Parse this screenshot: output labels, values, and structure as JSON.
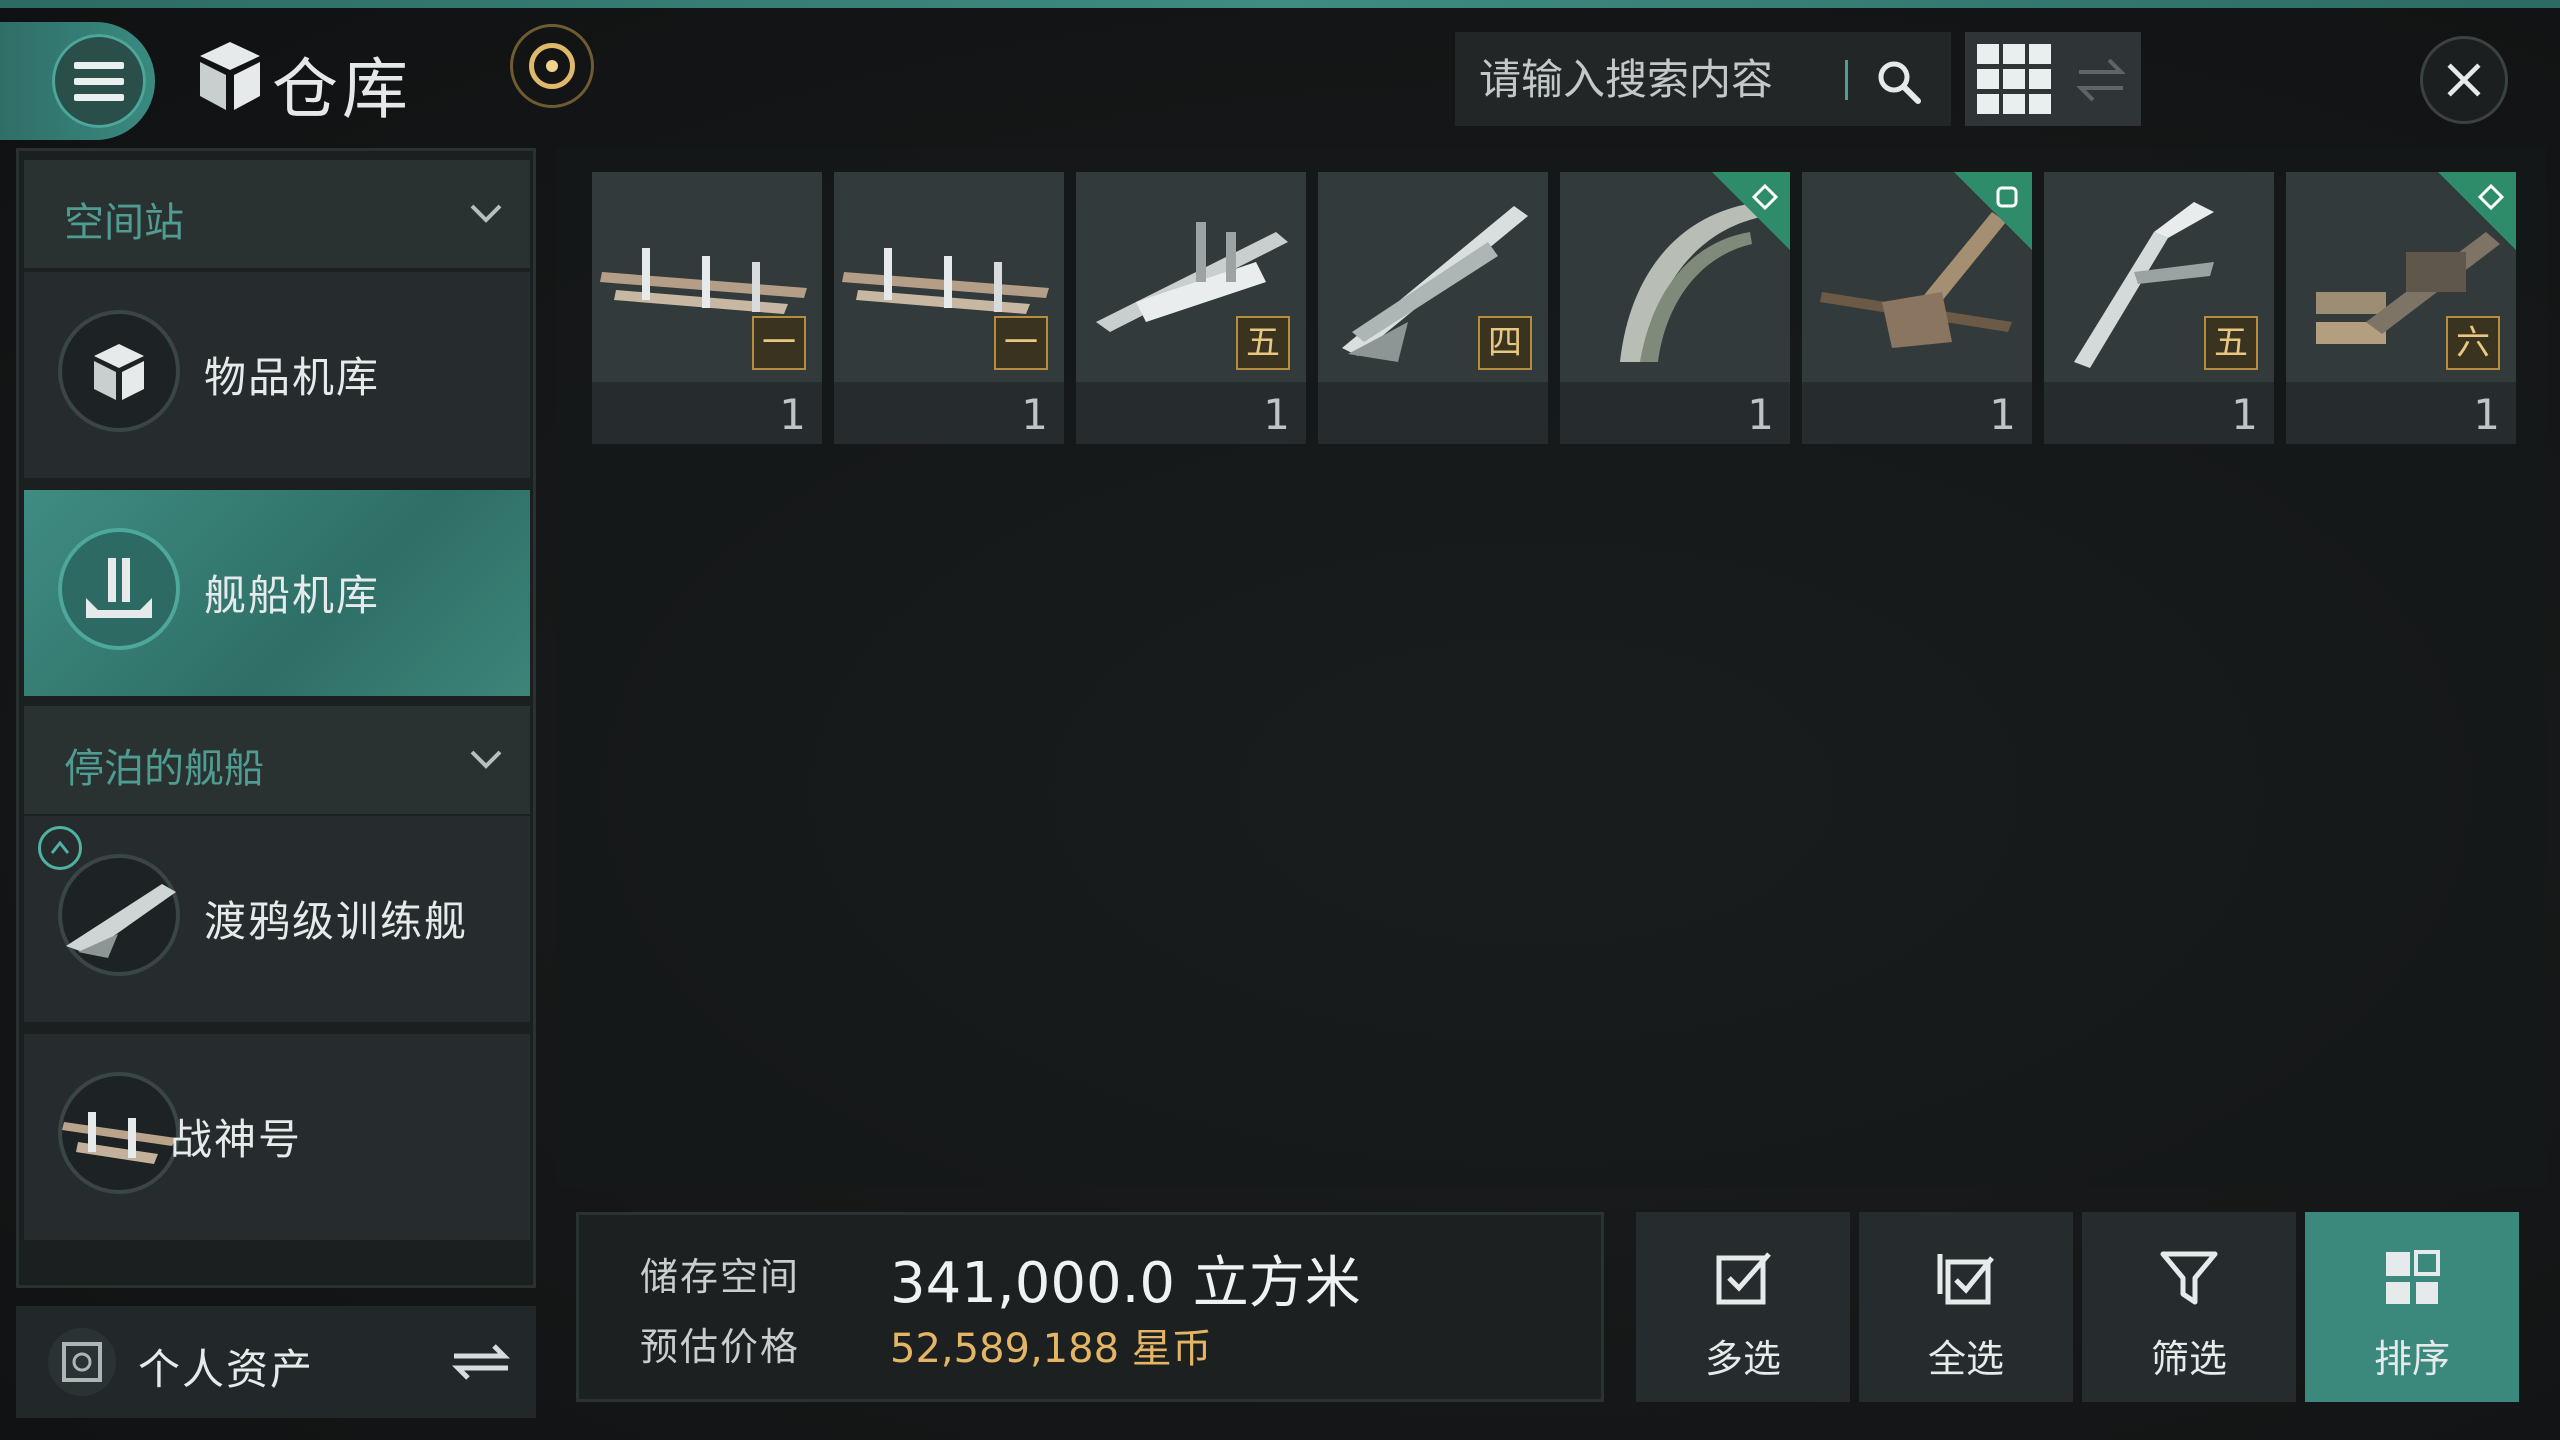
{
  "header": {
    "title": "仓库",
    "search_placeholder": "请输入搜索内容",
    "icons": [
      "menu-icon",
      "box-icon",
      "sun-icon",
      "search-icon",
      "grid-view-icon",
      "swap-icon",
      "close-icon"
    ]
  },
  "sidebar": {
    "station_label": "空间站",
    "items": [
      {
        "label": "物品机库",
        "icon": "box-icon",
        "active": false
      },
      {
        "label": "舰船机库",
        "icon": "ship-hangar-icon",
        "active": true
      }
    ],
    "docked_label": "停泊的舰船",
    "ships": [
      {
        "label": "渡鸦级训练舰",
        "icon": "ship-icon",
        "badge": "active-ship-badge"
      },
      {
        "label": "战神号",
        "icon": "ship-icon"
      }
    ],
    "assets_label": "个人资产"
  },
  "grid": {
    "items": [
      {
        "tier": "一",
        "qty": "1",
        "flag": ""
      },
      {
        "tier": "一",
        "qty": "1",
        "flag": ""
      },
      {
        "tier": "五",
        "qty": "1",
        "flag": ""
      },
      {
        "tier": "四",
        "qty": "",
        "flag": ""
      },
      {
        "tier": "",
        "qty": "1",
        "flag": "diamond"
      },
      {
        "tier": "",
        "qty": "1",
        "flag": "square"
      },
      {
        "tier": "五",
        "qty": "1",
        "flag": ""
      },
      {
        "tier": "六",
        "qty": "1",
        "flag": "diamond"
      }
    ]
  },
  "storage": {
    "space_label": "储存空间",
    "space_value": "341,000.0 立方米",
    "price_label": "预估价格",
    "price_value": "52,589,188 星币"
  },
  "actions": [
    {
      "label": "多选",
      "icon": "checkbox-icon",
      "active": false
    },
    {
      "label": "全选",
      "icon": "select-all-icon",
      "active": false
    },
    {
      "label": "筛选",
      "icon": "filter-icon",
      "active": false
    },
    {
      "label": "排序",
      "icon": "sort-icon",
      "active": true
    }
  ],
  "colors": {
    "accent": "#3b887d",
    "gold": "#e3b565",
    "panel": "#262c2d"
  }
}
